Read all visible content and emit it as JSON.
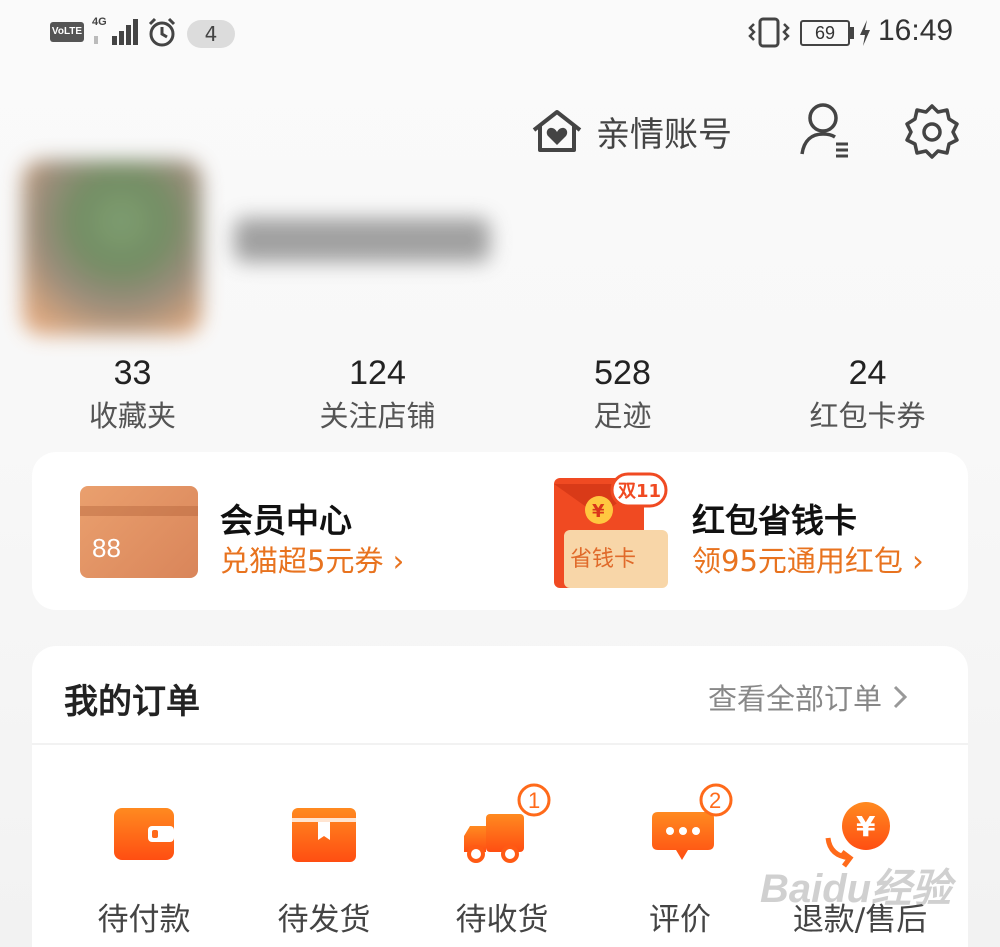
{
  "status_bar": {
    "volte": "VoLTE",
    "network": "4G",
    "notification_count": "4",
    "battery": "69",
    "time": "16:49"
  },
  "top_actions": {
    "family_account": "亲情账号"
  },
  "stats": [
    {
      "value": "33",
      "label": "收藏夹"
    },
    {
      "value": "124",
      "label": "关注店铺"
    },
    {
      "value": "528",
      "label": "足迹"
    },
    {
      "value": "24",
      "label": "红包卡券"
    }
  ],
  "promos": {
    "member": {
      "icon_text": "88",
      "title": "会员中心",
      "subtitle": "兑猫超5元券 ›"
    },
    "redpack": {
      "badge": "双11",
      "card_text": "省钱卡",
      "title": "红包省钱卡",
      "subtitle": "领95元通用红包 ›"
    }
  },
  "orders": {
    "title": "我的订单",
    "view_all": "查看全部订单",
    "items": [
      {
        "label": "待付款",
        "icon": "wallet-icon",
        "badge": ""
      },
      {
        "label": "待发货",
        "icon": "package-icon",
        "badge": ""
      },
      {
        "label": "待收货",
        "icon": "truck-icon",
        "badge": "1"
      },
      {
        "label": "评价",
        "icon": "comment-icon",
        "badge": "2"
      },
      {
        "label": "退款/售后",
        "icon": "refund-icon",
        "badge": ""
      }
    ]
  },
  "watermark": "Baidu经验",
  "colors": {
    "accent_orange": "#ff6a1a",
    "link_orange": "#e8731f",
    "background": "#f4f4f4"
  }
}
